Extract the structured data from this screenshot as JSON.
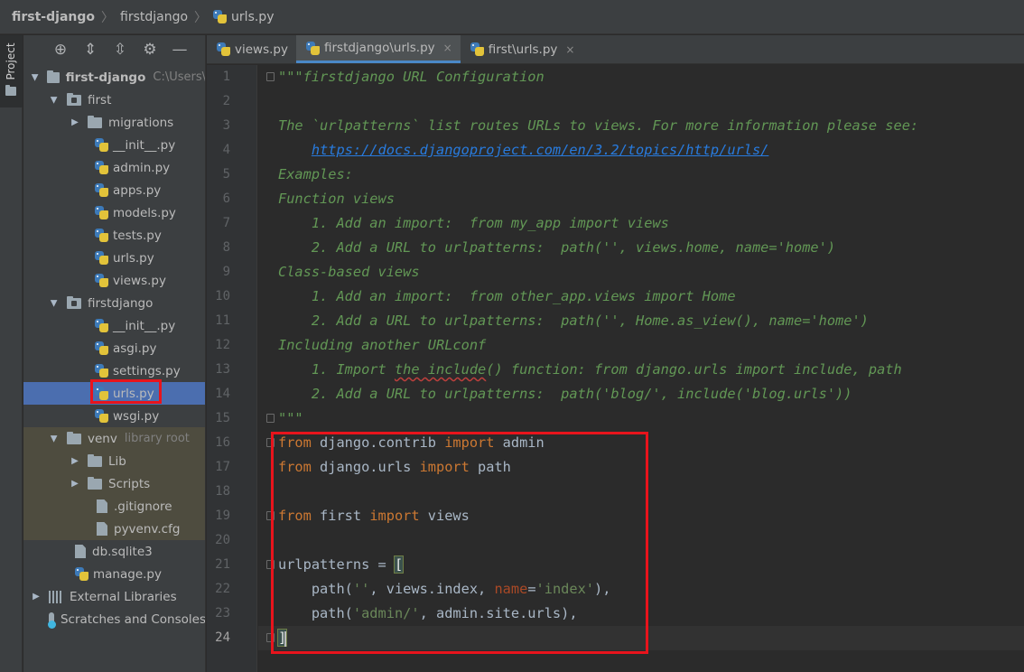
{
  "breadcrumb": {
    "project": "first-django",
    "folder": "firstdjango",
    "file": "urls.py"
  },
  "toolstrip": {
    "project_tab": "Project"
  },
  "project_panel": {
    "toolbar_icons": [
      "locate-icon",
      "expand-all-icon",
      "collapse-all-icon",
      "gear-icon",
      "minimize-icon"
    ],
    "tree": {
      "root": {
        "name": "first-django",
        "path_hint": "C:\\Users\\"
      },
      "first_folder": "first",
      "first_children": [
        "migrations",
        "__init__.py",
        "admin.py",
        "apps.py",
        "models.py",
        "tests.py",
        "urls.py",
        "views.py"
      ],
      "firstdjango_folder": "firstdjango",
      "firstdjango_children": [
        "__init__.py",
        "asgi.py",
        "settings.py",
        "urls.py",
        "wsgi.py"
      ],
      "venv": {
        "name": "venv",
        "hint": "library root"
      },
      "venv_children": [
        "Lib",
        "Scripts",
        ".gitignore",
        "pyvenv.cfg"
      ],
      "root_files": [
        "db.sqlite3",
        "manage.py"
      ],
      "external_libraries": "External Libraries",
      "scratches": "Scratches and Consoles"
    },
    "selected_item": "urls.py"
  },
  "tabs": [
    {
      "label": "views.py",
      "active": false
    },
    {
      "label": "firstdjango\\urls.py",
      "active": true
    },
    {
      "label": "first\\urls.py",
      "active": false
    }
  ],
  "tab_close_glyph": "×",
  "editor": {
    "current_line": 24,
    "line_numbers": [
      "1",
      "2",
      "3",
      "4",
      "5",
      "6",
      "7",
      "8",
      "9",
      "10",
      "11",
      "12",
      "13",
      "14",
      "15",
      "16",
      "17",
      "18",
      "19",
      "20",
      "21",
      "22",
      "23",
      "24"
    ],
    "docstring": {
      "l1": "\"\"\"firstdjango URL Configuration",
      "l3": "The `urlpatterns` list routes URLs to views. For more information please see:",
      "l4_indent": "    ",
      "l4_link": "https://docs.djangoproject.com/en/3.2/topics/http/urls/",
      "l5": "Examples:",
      "l6": "Function views",
      "l7": "    1. Add an import:  from my_app import views",
      "l8": "    2. Add a URL to urlpatterns:  path('', views.home, name='home')",
      "l9": "Class-based views",
      "l10": "    1. Add an import:  from other_app.views import Home",
      "l11": "    2. Add a URL to urlpatterns:  path('', Home.as_view(), name='home')",
      "l12": "Including another URLconf",
      "l13_a": "    1. Import ",
      "l13_b": "the include",
      "l13_c": "() function: from django.urls import include, path",
      "l14": "    2. Add a URL to urlpatterns:  path('blog/', include('blog.urls'))",
      "l15": "\"\"\""
    },
    "code": {
      "l16_kw1": "from",
      "l16_mod": " django.contrib ",
      "l16_kw2": "import",
      "l16_name": " admin",
      "l17_kw1": "from",
      "l17_mod": " django.urls ",
      "l17_kw2": "import",
      "l17_name": " path",
      "l19_kw1": "from",
      "l19_mod": " first ",
      "l19_kw2": "import",
      "l19_name": " views",
      "l21_name": "urlpatterns = ",
      "l21_bracket": "[",
      "l22_a": "    path(",
      "l22_s1": "''",
      "l22_b": ", views.index, ",
      "l22_p": "name",
      "l22_c": "=",
      "l22_s2": "'index'",
      "l22_d": "),",
      "l23_a": "    path(",
      "l23_s1": "'admin/'",
      "l23_b": ", admin.site.urls),",
      "l24_bracket": "]"
    }
  }
}
